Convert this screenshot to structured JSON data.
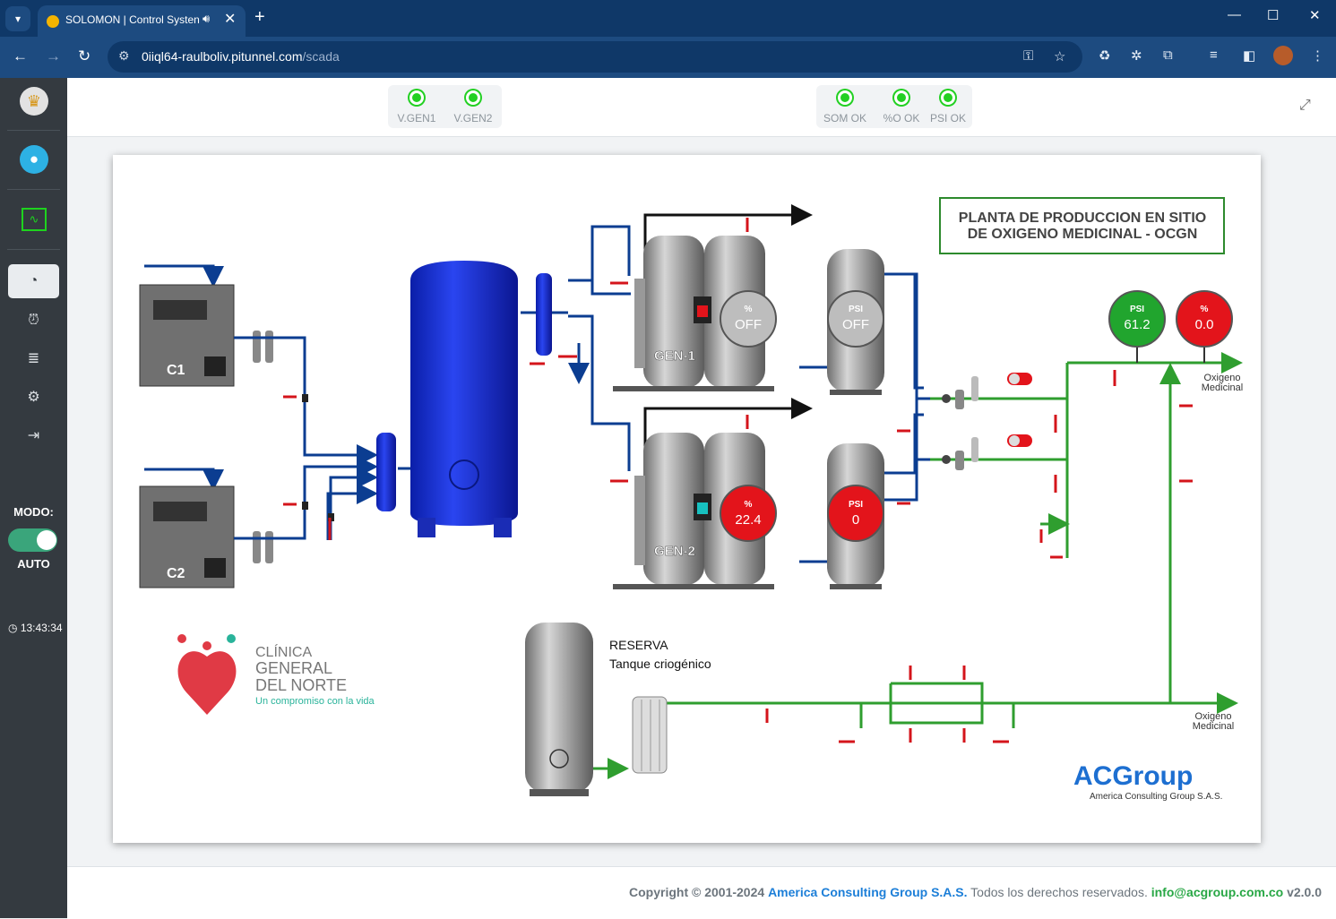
{
  "browser": {
    "tab_title": "SOLOMON | Control Systen",
    "url_host": "0iiql64-raulboliv.pitunnel.com",
    "url_path": "/scada"
  },
  "sidebar": {
    "mode_label": "MODO:",
    "mode_value": "AUTO",
    "clock": "13:43:34"
  },
  "status_indicators": {
    "group1": [
      "V.GEN1",
      "V.GEN2"
    ],
    "group2": [
      "SOM OK",
      "%O OK",
      "PSI OK"
    ]
  },
  "scada": {
    "title_line1": "PLANTA DE PRODUCCION EN SITIO",
    "title_line2_prefix": "DE OXIGENO MEDICINAL - ",
    "title_line2_bold": "OCGN",
    "compressors": [
      "C1",
      "C2"
    ],
    "generators": [
      {
        "label": "GEN-1",
        "gauge_unit": "%",
        "gauge_value": "OFF",
        "tank_unit": "PSI",
        "tank_value": "OFF",
        "state": "off"
      },
      {
        "label": "GEN-2",
        "gauge_unit": "%",
        "gauge_value": "22.4",
        "tank_unit": "PSI",
        "tank_value": "0",
        "state": "alarm"
      }
    ],
    "outlet_gauges": [
      {
        "unit": "PSI",
        "value": "61.2",
        "color": "#21a52e"
      },
      {
        "unit": "%",
        "value": "0.0",
        "color": "#e3141b"
      }
    ],
    "outlet_label_line1": "Oxigeno",
    "outlet_label_line2": "Medicinal",
    "reserve_title": "RESERVA",
    "reserve_subtitle": "Tanque criogénico",
    "clinic_line1": "CLÍNICA",
    "clinic_line2": "GENERAL",
    "clinic_line3": "DEL NORTE",
    "clinic_tagline": "Un compromiso con la vida",
    "company_logo": "ACGroup",
    "company_name": "America Consulting Group S.A.S."
  },
  "footer": {
    "prefix": "Copyright © 2001-2024",
    "company": "America Consulting Group S.A.S.",
    "rights": "Todos los derechos reservados.",
    "email": "info@acgroup.com.co",
    "version": "v2.0.0"
  },
  "colors": {
    "chrome_dark": "#0f3868",
    "chrome": "#1d4b80",
    "sidebar": "#343a40",
    "led_on": "#22d022",
    "pipe_blue": "#0b3d91",
    "pipe_green": "#2f9e2f",
    "valve_red": "#d4141b"
  }
}
